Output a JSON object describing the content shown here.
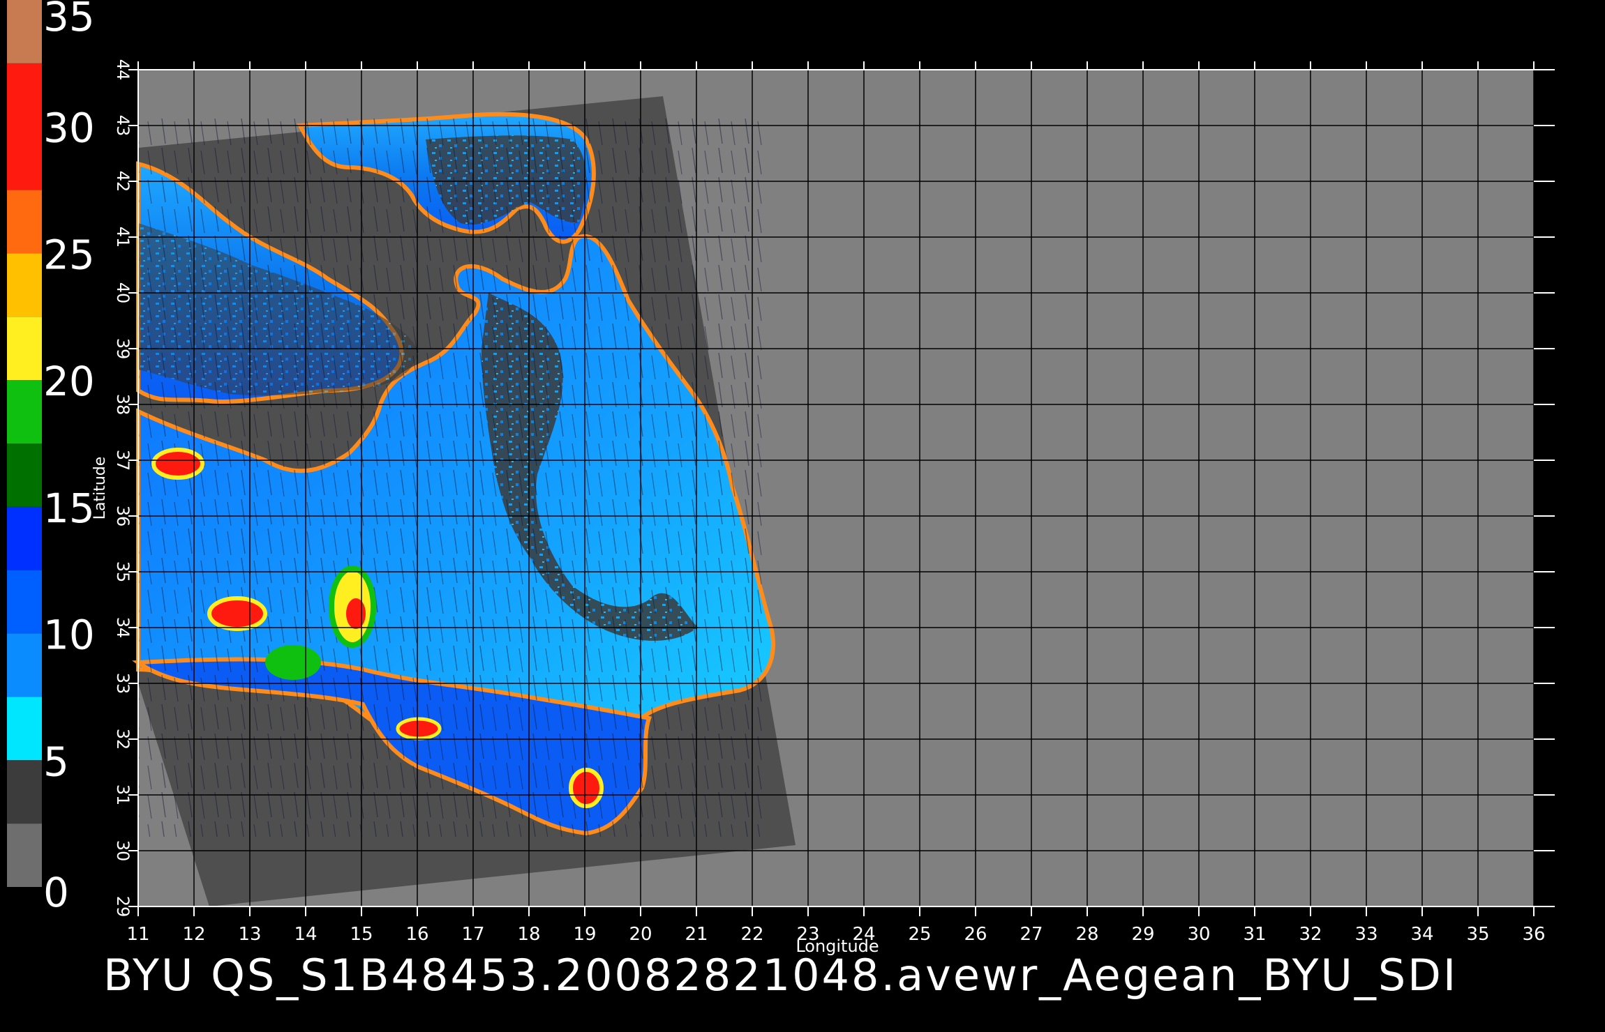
{
  "map": {
    "footer_title": "BYU QS_S1B48453.20082821048.avewr_Aegean_BYU_SDI",
    "x_axis_label": "Longitude",
    "y_axis_label": "Latitude",
    "lon_ticks": [
      "11",
      "12",
      "13",
      "14",
      "15",
      "16",
      "17",
      "18",
      "19",
      "20",
      "21",
      "22",
      "23",
      "24",
      "25",
      "26",
      "27",
      "28",
      "29",
      "30",
      "31",
      "32",
      "33",
      "34",
      "35",
      "36"
    ],
    "lat_ticks": [
      "29",
      "30",
      "31",
      "32",
      "33",
      "34",
      "35",
      "36",
      "37",
      "38",
      "39",
      "40",
      "41",
      "42",
      "43",
      "44"
    ],
    "lon_range": [
      11,
      36
    ],
    "lat_range": [
      29,
      44
    ],
    "colors": {
      "background": "#000000",
      "map_fill": "#808080",
      "swath_fill": "#4f4f4f",
      "land_pattern": "#3a3a3a",
      "grid_line": "#000000",
      "axis_line": "#ffffff"
    }
  },
  "colorbar": {
    "labels": [
      "35",
      "30",
      "25",
      "20",
      "15",
      "10",
      "5",
      "0"
    ],
    "segments": [
      {
        "from": 32.5,
        "to": 35,
        "color": "#c87a50"
      },
      {
        "from": 27.5,
        "to": 32.5,
        "color": "#ff1a10"
      },
      {
        "from": 25,
        "to": 27.5,
        "color": "#ff6a10"
      },
      {
        "from": 22.5,
        "to": 25,
        "color": "#ffc000"
      },
      {
        "from": 20,
        "to": 22.5,
        "color": "#ffee20"
      },
      {
        "from": 17.5,
        "to": 20,
        "color": "#10c010"
      },
      {
        "from": 15,
        "to": 17.5,
        "color": "#007000"
      },
      {
        "from": 12.5,
        "to": 15,
        "color": "#0030ff"
      },
      {
        "from": 10,
        "to": 12.5,
        "color": "#0060ff"
      },
      {
        "from": 7.5,
        "to": 10,
        "color": "#0a8cff"
      },
      {
        "from": 5,
        "to": 7.5,
        "color": "#00e6ff"
      },
      {
        "from": 2.5,
        "to": 5,
        "color": "#3c3c3c"
      },
      {
        "from": 0,
        "to": 2.5,
        "color": "#6e6e6e"
      }
    ]
  }
}
